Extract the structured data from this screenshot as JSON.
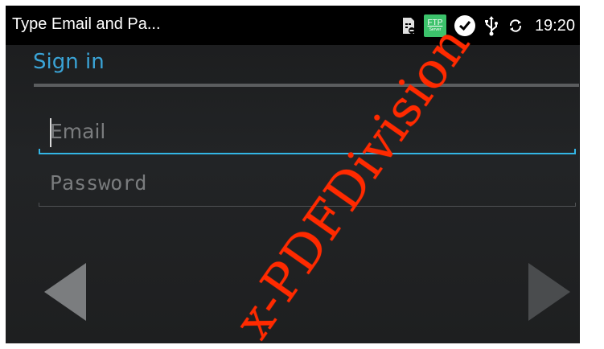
{
  "statusbar": {
    "title": "Type Email and Pa...",
    "ftp_label": "FTP",
    "ftp_sub": "Server",
    "time": "19:20"
  },
  "signin": {
    "title": "Sign in"
  },
  "fields": {
    "email_placeholder": "Email",
    "email_value": "",
    "password_placeholder": "Password",
    "password_value": ""
  },
  "watermark": {
    "text": "x-PDFDivision"
  },
  "colors": {
    "accent": "#33b5e5",
    "title_blue": "#3aa3d6",
    "watermark": "#ff2a00"
  }
}
